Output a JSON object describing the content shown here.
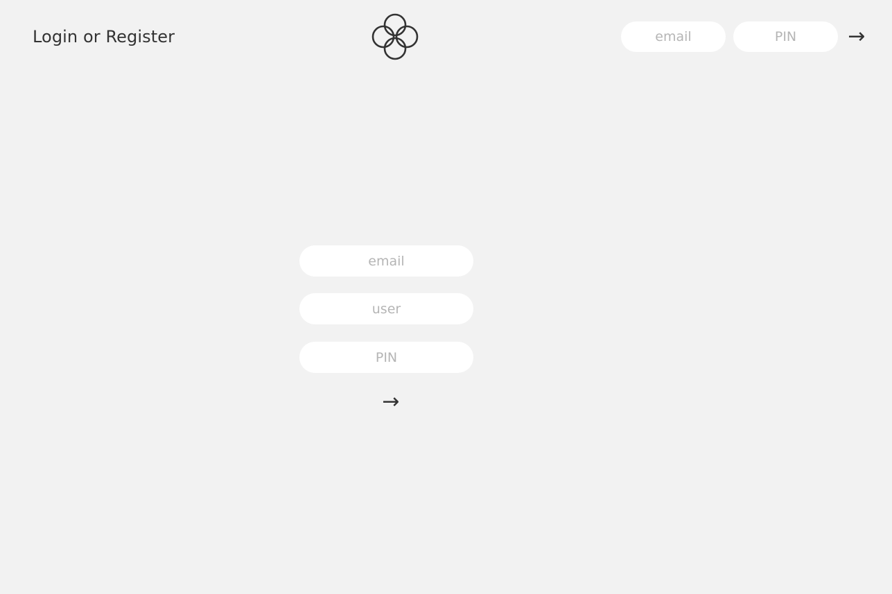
{
  "header": {
    "title": "Login or Register",
    "logo_icon": "four-circles-logo-icon",
    "login": {
      "email_placeholder": "email",
      "email_value": "",
      "pin_placeholder": "PIN",
      "pin_value": "",
      "submit_label": "→"
    }
  },
  "register_form": {
    "email_placeholder": "email",
    "email_value": "",
    "user_placeholder": "user",
    "user_value": "",
    "pin_placeholder": "PIN",
    "pin_value": "",
    "submit_label": "→"
  },
  "colors": {
    "background": "#f2f2f2",
    "input_background": "#ffffff",
    "text": "#333333",
    "placeholder": "#b5b5b5"
  }
}
